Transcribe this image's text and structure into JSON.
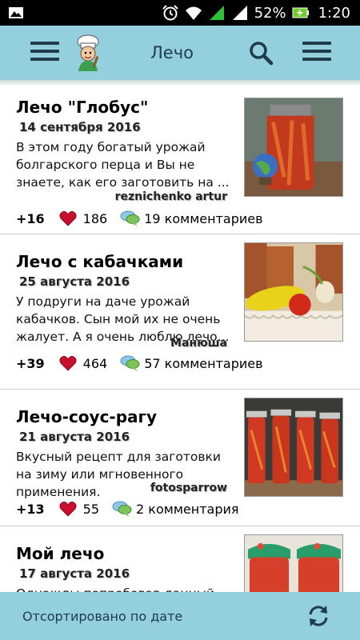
{
  "status_bar": {
    "battery_percent": "52%",
    "time": "1:20",
    "icons": [
      "image-icon",
      "alarm-icon",
      "wifi-icon",
      "signal-icon",
      "signal-2-icon",
      "battery-charging-icon"
    ]
  },
  "app_bar": {
    "title": "Лечо",
    "icons": [
      "menu-icon",
      "chef-logo-icon",
      "search-icon",
      "overflow-menu-icon"
    ],
    "color": "#93cfdc"
  },
  "recipes": [
    {
      "title": "Лечо \"Глобус\"",
      "date": "14 сентября 2016",
      "description": "В этом году богатый урожай болгарского перца и Вы не знаете, как его заготовить на ...",
      "author": "reznichenko artur",
      "score": "+16",
      "likes": "186",
      "comments": "19 комментариев"
    },
    {
      "title": "Лечо с кабачками",
      "date": "25 августа 2016",
      "description": "У подруги на даче урожай кабачков. Сын мой их не очень жалует. А я очень люблю лечо...",
      "author": "Манюша",
      "score": "+39",
      "likes": "464",
      "comments": "57 комментариев"
    },
    {
      "title": "Лечо-соус-рагу",
      "date": "21 августа 2016",
      "description": "Вкусный рецепт для заготовки на зиму или мгновенного применения.",
      "author": "fotosparrow",
      "score": "+13",
      "likes": "55",
      "comments": "2 комментария"
    },
    {
      "title": "Мой лечо",
      "date": "17 августа 2016",
      "description": "Однажды попробовав данный"
    }
  ],
  "bottom_bar": {
    "sort_label": "Отсортировано по дате",
    "icon": "refresh-icon"
  }
}
